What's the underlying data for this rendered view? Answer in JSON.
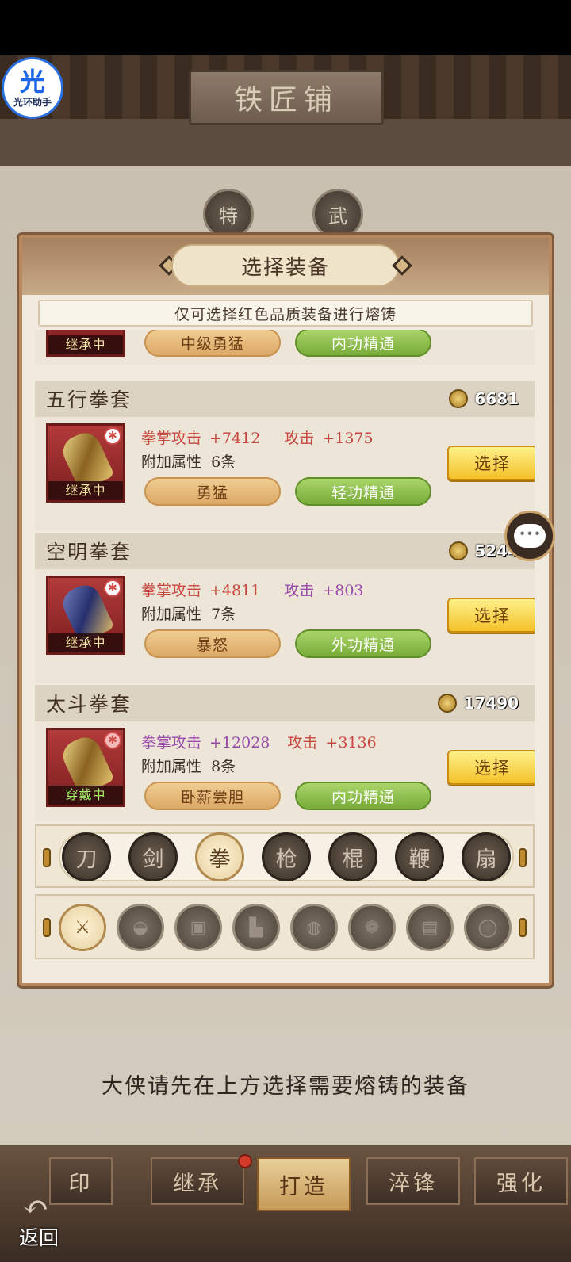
{
  "app_badge": {
    "icon": "光",
    "label": "光环助手"
  },
  "shop_sign": "铁匠铺",
  "bg_tabs": [
    "特",
    "武"
  ],
  "modal": {
    "title": "选择装备",
    "notice": "仅可选择红色品质装备进行熔铸",
    "partial_card": {
      "status": "继承中",
      "tag1": "中级勇猛",
      "tag2": "内功精通"
    },
    "items": [
      {
        "name": "五行拳套",
        "power": "6681",
        "status": "继承中",
        "stat1_label": "拳掌攻击",
        "stat1_value": "+7412",
        "stat2_label": "攻击",
        "stat2_value": "+1375",
        "extra_label": "附加属性",
        "extra_value": "6条",
        "tag1": "勇猛",
        "tag2": "轻功精通",
        "select": "选择"
      },
      {
        "name": "空明拳套",
        "power": "5244",
        "status": "继承中",
        "stat1_label": "拳掌攻击",
        "stat1_value": "+4811",
        "stat2_label": "攻击",
        "stat2_value": "+803",
        "extra_label": "附加属性",
        "extra_value": "7条",
        "tag1": "暴怒",
        "tag2": "外功精通",
        "select": "选择"
      },
      {
        "name": "太斗拳套",
        "power": "17490",
        "status": "穿戴中",
        "stat1_label": "拳掌攻击",
        "stat1_value": "+12028",
        "stat2_label": "攻击",
        "stat2_value": "+3136",
        "extra_label": "附加属性",
        "extra_value": "8条",
        "tag1": "卧薪尝胆",
        "tag2": "内功精通",
        "select": "选择"
      }
    ],
    "weapon_types": [
      "刀",
      "剑",
      "拳",
      "枪",
      "棍",
      "鞭",
      "扇"
    ],
    "selected_weapon_type": "拳",
    "slot_icons": [
      "weapon-slot-icon",
      "helmet-slot-icon",
      "armor-slot-icon",
      "boots-slot-icon",
      "belt-slot-icon",
      "pendant-slot-icon",
      "scroll-slot-icon",
      "ring-slot-icon"
    ]
  },
  "hint": "大侠请先在上方选择需要熔铸的装备",
  "bottom_nav": {
    "tabs": [
      "印",
      "继承",
      "打造",
      "淬锋",
      "强化"
    ],
    "active": "打造",
    "back_label": "返回"
  },
  "colors": {
    "stat_red": "#c8473e",
    "stat_purple": "#9a4aa8",
    "select_gold": "#f4c22a",
    "pill_green": "#79ac3a"
  }
}
